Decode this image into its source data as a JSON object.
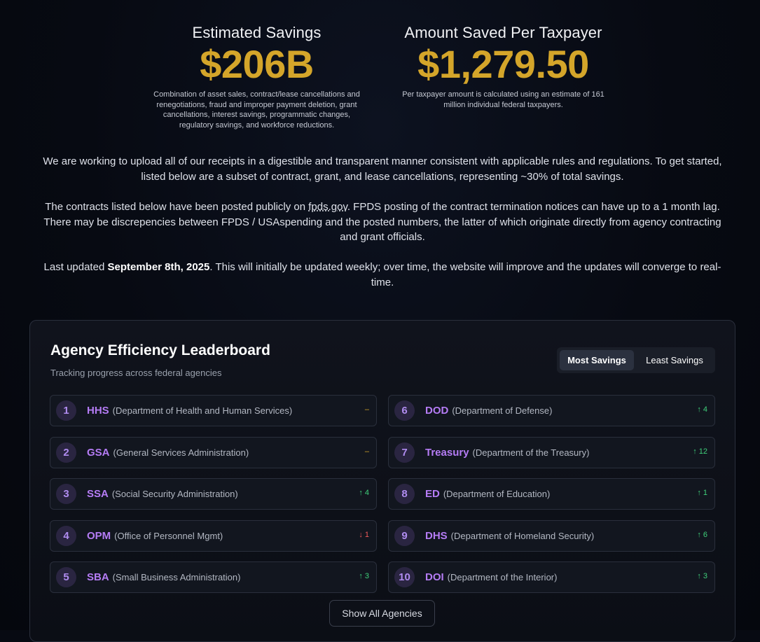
{
  "stats": [
    {
      "label": "Estimated Savings",
      "value": "$206B",
      "description": "Combination of asset sales, contract/lease cancellations and renegotiations, fraud and improper payment deletion, grant cancellations, interest savings, programmatic changes, regulatory savings, and workforce reductions."
    },
    {
      "label": "Amount Saved Per Taxpayer",
      "value": "$1,279.50",
      "description": "Per taxpayer amount is calculated using an estimate of 161 million individual federal taxpayers."
    }
  ],
  "intro": {
    "p1": "We are working to upload all of our receipts in a digestible and transparent manner consistent with applicable rules and regulations. To get started, listed below are a subset of contract, grant, and lease cancellations, representing ~30% of total savings.",
    "p2_before": "The contracts listed below have been posted publicly on ",
    "p2_link": "fpds.gov",
    "p2_after": ". FPDS posting of the contract termination notices can have up to a 1 month lag. There may be discrepencies between FPDS / USAspending and the posted numbers, the latter of which originate directly from agency contracting and grant officials.",
    "p3_before": "Last updated ",
    "p3_date": "September 8th, 2025",
    "p3_after": ". This will initially be updated weekly; over time, the website will improve and the updates will converge to real-time."
  },
  "leaderboard": {
    "title": "Agency Efficiency Leaderboard",
    "subtitle": "Tracking progress across federal agencies",
    "toggle": {
      "most": "Most Savings",
      "least": "Least Savings"
    },
    "show_all": "Show All Agencies",
    "agencies": [
      {
        "rank": "1",
        "abbr": "HHS",
        "full": "(Department of Health and Human Services)",
        "change": "–",
        "trend": "same"
      },
      {
        "rank": "6",
        "abbr": "DOD",
        "full": "(Department of Defense)",
        "change": "↑ 4",
        "trend": "up"
      },
      {
        "rank": "2",
        "abbr": "GSA",
        "full": "(General Services Administration)",
        "change": "–",
        "trend": "same"
      },
      {
        "rank": "7",
        "abbr": "Treasury",
        "full": "(Department of the Treasury)",
        "change": "↑ 12",
        "trend": "up"
      },
      {
        "rank": "3",
        "abbr": "SSA",
        "full": "(Social Security Administration)",
        "change": "↑ 4",
        "trend": "up"
      },
      {
        "rank": "8",
        "abbr": "ED",
        "full": "(Department of Education)",
        "change": "↑ 1",
        "trend": "up"
      },
      {
        "rank": "4",
        "abbr": "OPM",
        "full": "(Office of Personnel Mgmt)",
        "change": "↓ 1",
        "trend": "down"
      },
      {
        "rank": "9",
        "abbr": "DHS",
        "full": "(Department of Homeland Security)",
        "change": "↑ 6",
        "trend": "up"
      },
      {
        "rank": "5",
        "abbr": "SBA",
        "full": "(Small Business Administration)",
        "change": "↑ 3",
        "trend": "up"
      },
      {
        "rank": "10",
        "abbr": "DOI",
        "full": "(Department of the Interior)",
        "change": "↑ 3",
        "trend": "up"
      }
    ]
  }
}
